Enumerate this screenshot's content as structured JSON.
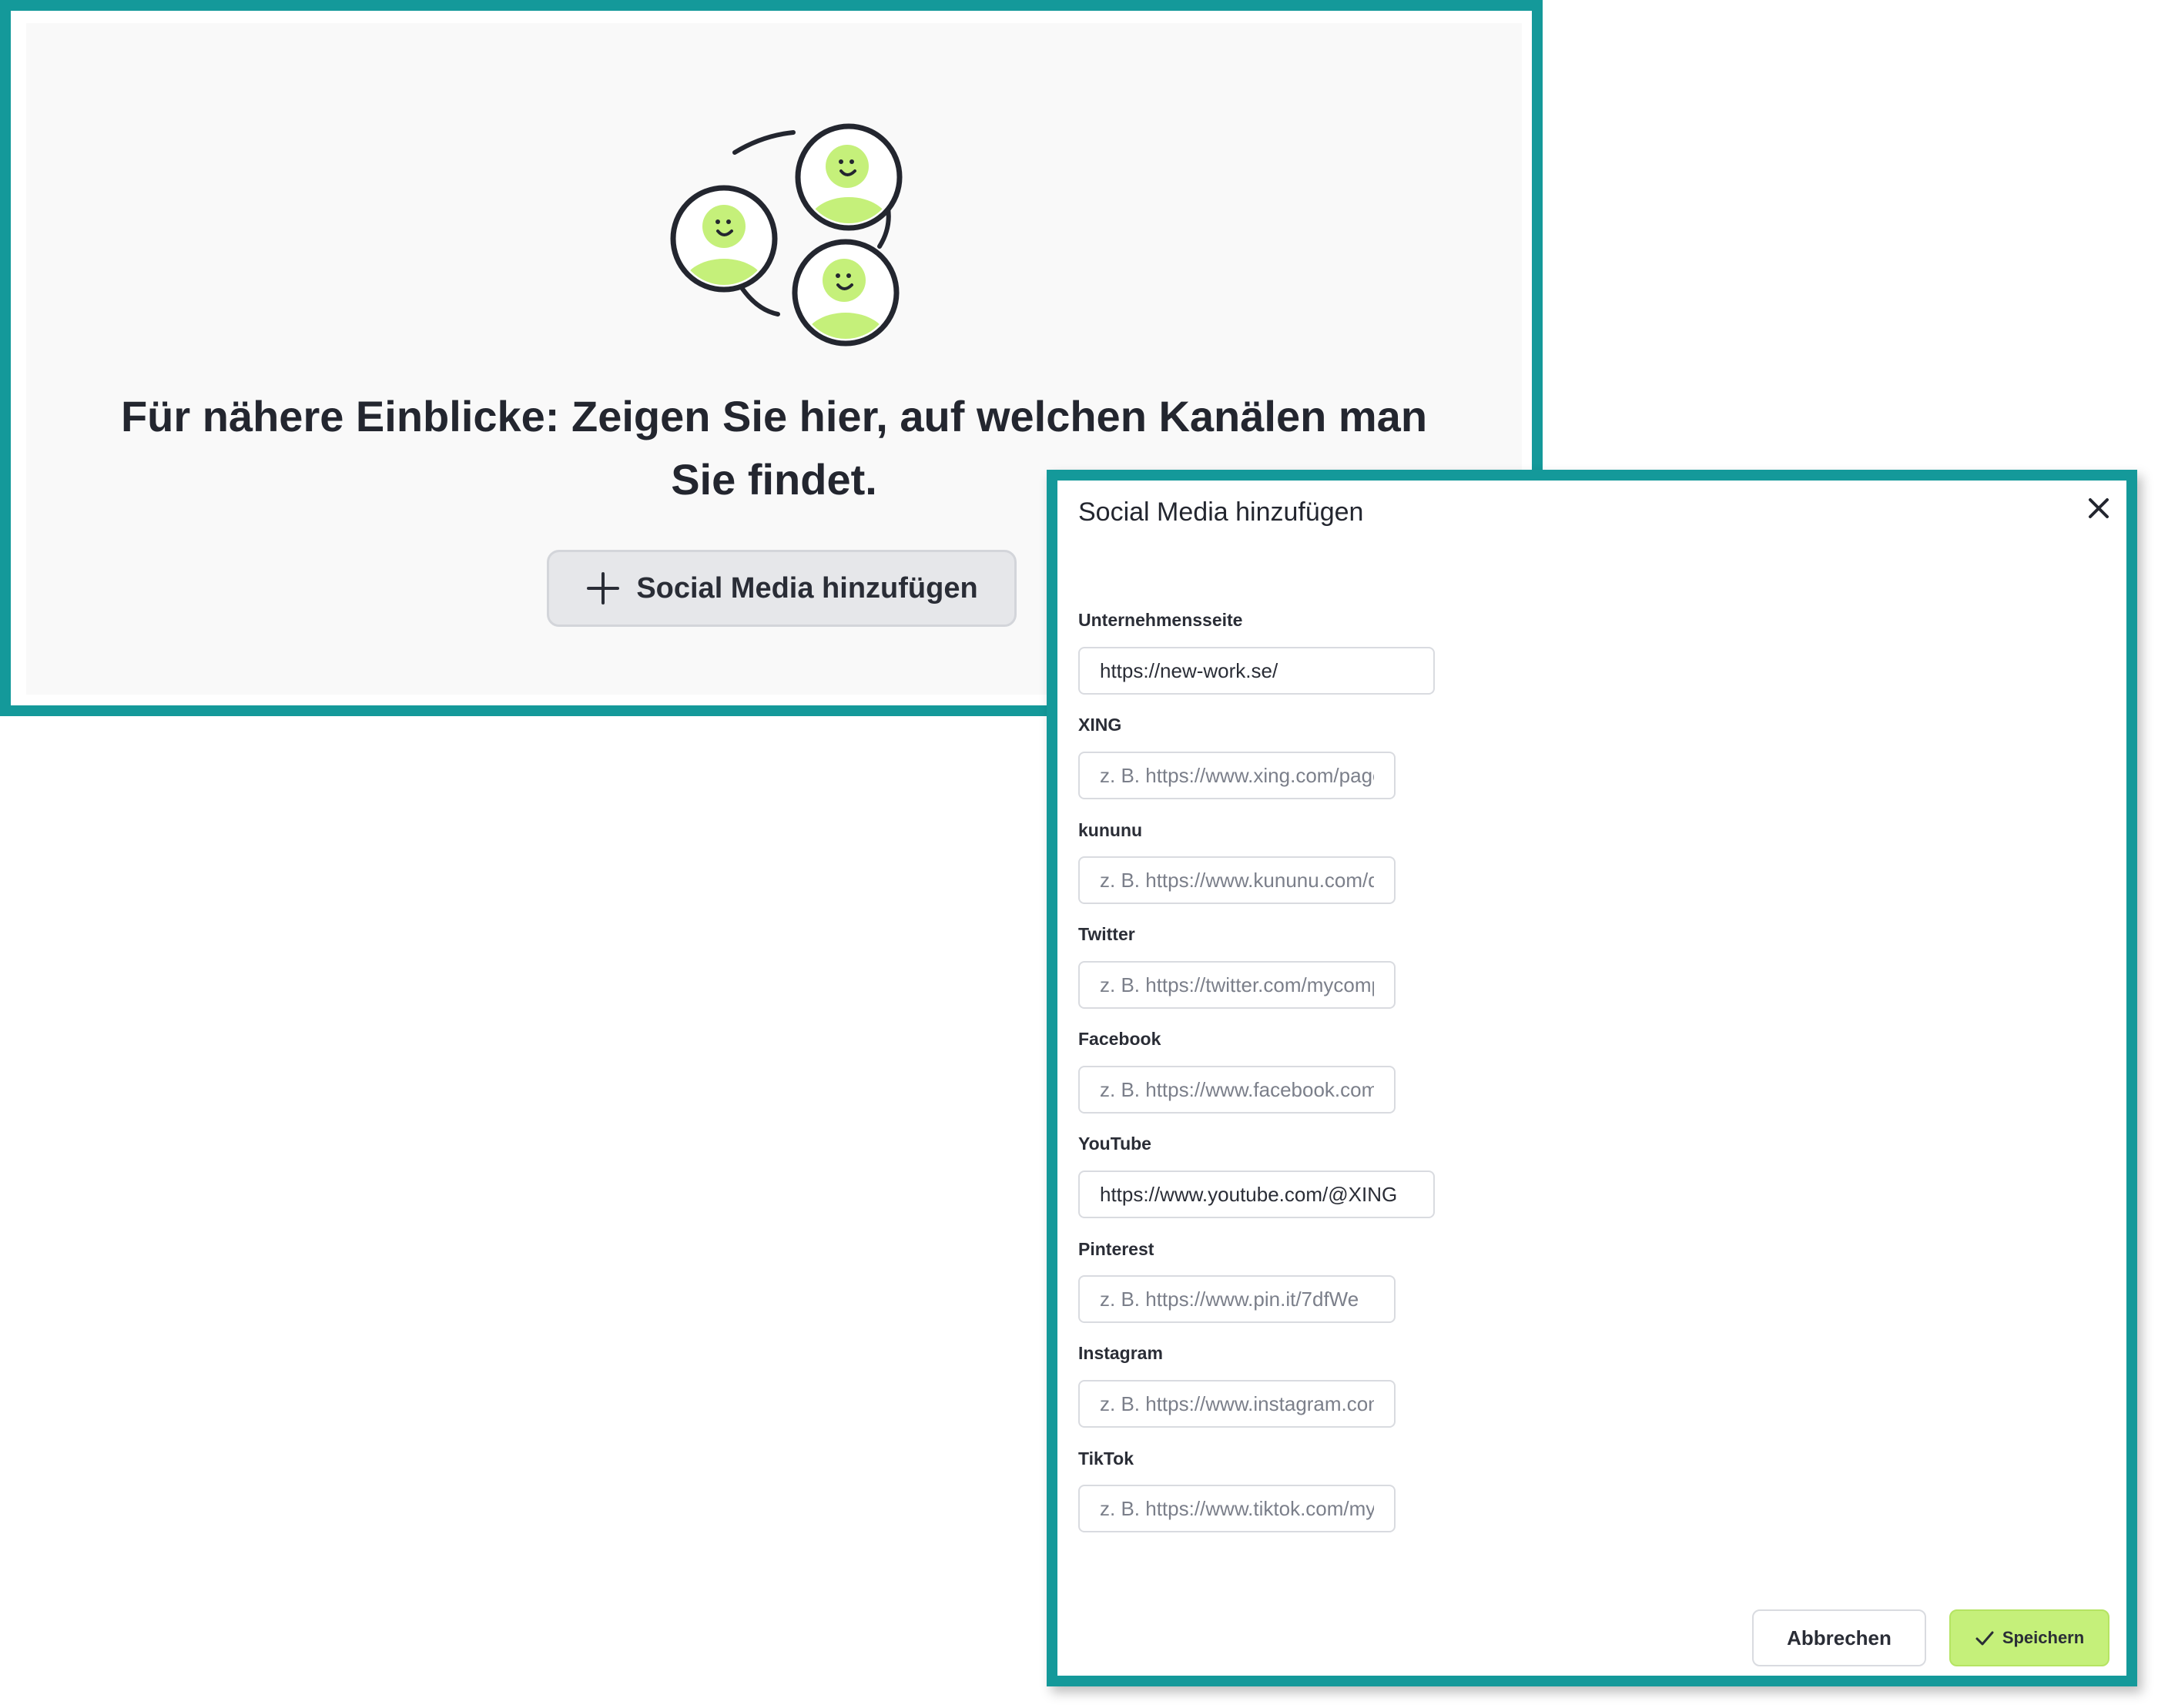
{
  "empty_state": {
    "title_line1": "Für nähere Einblicke: Zeigen Sie hier, auf welchen Kanälen man",
    "title_line2": "Sie findet.",
    "add_button_label": "Social Media hinzufügen",
    "illustration_icon": "connected-people-illustration",
    "accent_color": "#c5f07a"
  },
  "modal": {
    "title": "Social Media hinzufügen",
    "close_icon": "close-icon",
    "fields": [
      {
        "label": "Unternehmensseite",
        "value": "https://new-work.se/",
        "placeholder": ""
      },
      {
        "label": "XING",
        "value": "",
        "placeholder": "z. B. https://www.xing.com/pages/mycompany"
      },
      {
        "label": "kununu",
        "value": "",
        "placeholder": "z. B. https://www.kununu.com/de/mycompany"
      },
      {
        "label": "Twitter",
        "value": "",
        "placeholder": "z. B. https://twitter.com/mycompany"
      },
      {
        "label": "Facebook",
        "value": "",
        "placeholder": "z. B. https://www.facebook.com/mycompany"
      },
      {
        "label": "YouTube",
        "value": "https://www.youtube.com/@XING",
        "placeholder": ""
      },
      {
        "label": "Pinterest",
        "value": "",
        "placeholder": "z. B. https://www.pin.it/7dfWe"
      },
      {
        "label": "Instagram",
        "value": "",
        "placeholder": "z. B. https://www.instagram.com/mycompany"
      },
      {
        "label": "TikTok",
        "value": "",
        "placeholder": "z. B. https://www.tiktok.com/mycompany"
      }
    ],
    "cancel_label": "Abbrechen",
    "save_label": "Speichern"
  },
  "colors": {
    "frame": "#14999a",
    "save_button": "#c5f07a"
  }
}
